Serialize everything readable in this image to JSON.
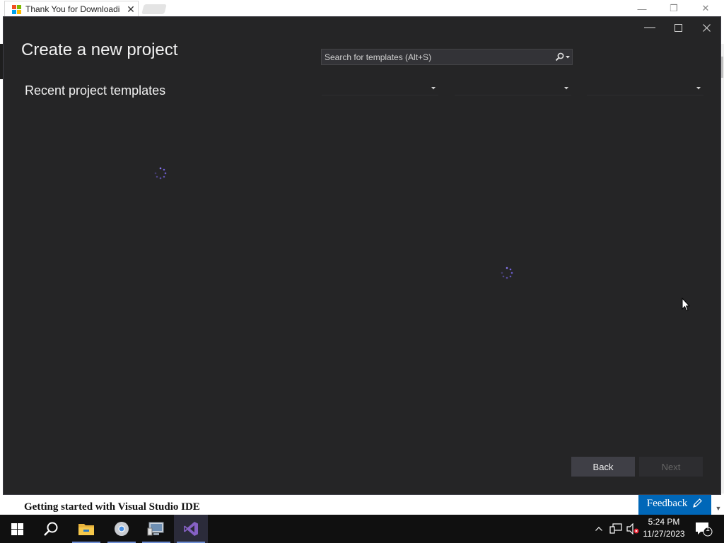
{
  "browser": {
    "tab_title": "Thank You for Downloadi",
    "close_glyph": "✕",
    "window_min": "—",
    "window_restore": "❐",
    "window_close": "✕",
    "page_title": "Getting started with Visual Studio IDE",
    "feedback_label": "Feedback"
  },
  "dialog": {
    "title": "Create a new project",
    "recent_heading": "Recent project templates",
    "search_placeholder": "Search for templates (Alt+S)",
    "filters": [
      "",
      "",
      ""
    ],
    "back_label": "Back",
    "next_label": "Next",
    "controls": {
      "minimize": "—",
      "maximize": "☐",
      "close": "✕"
    }
  },
  "taskbar": {
    "items": [
      "start-icon",
      "search-icon",
      "file-explorer-icon",
      "chrome-icon",
      "network-settings-icon",
      "visual-studio-icon"
    ],
    "time": "5:24 PM",
    "date": "11/27/2023",
    "notification_count": "1"
  },
  "colors": {
    "dialog_bg": "#252526",
    "accent": "#0067b8",
    "spinner": "#7b68ee"
  }
}
